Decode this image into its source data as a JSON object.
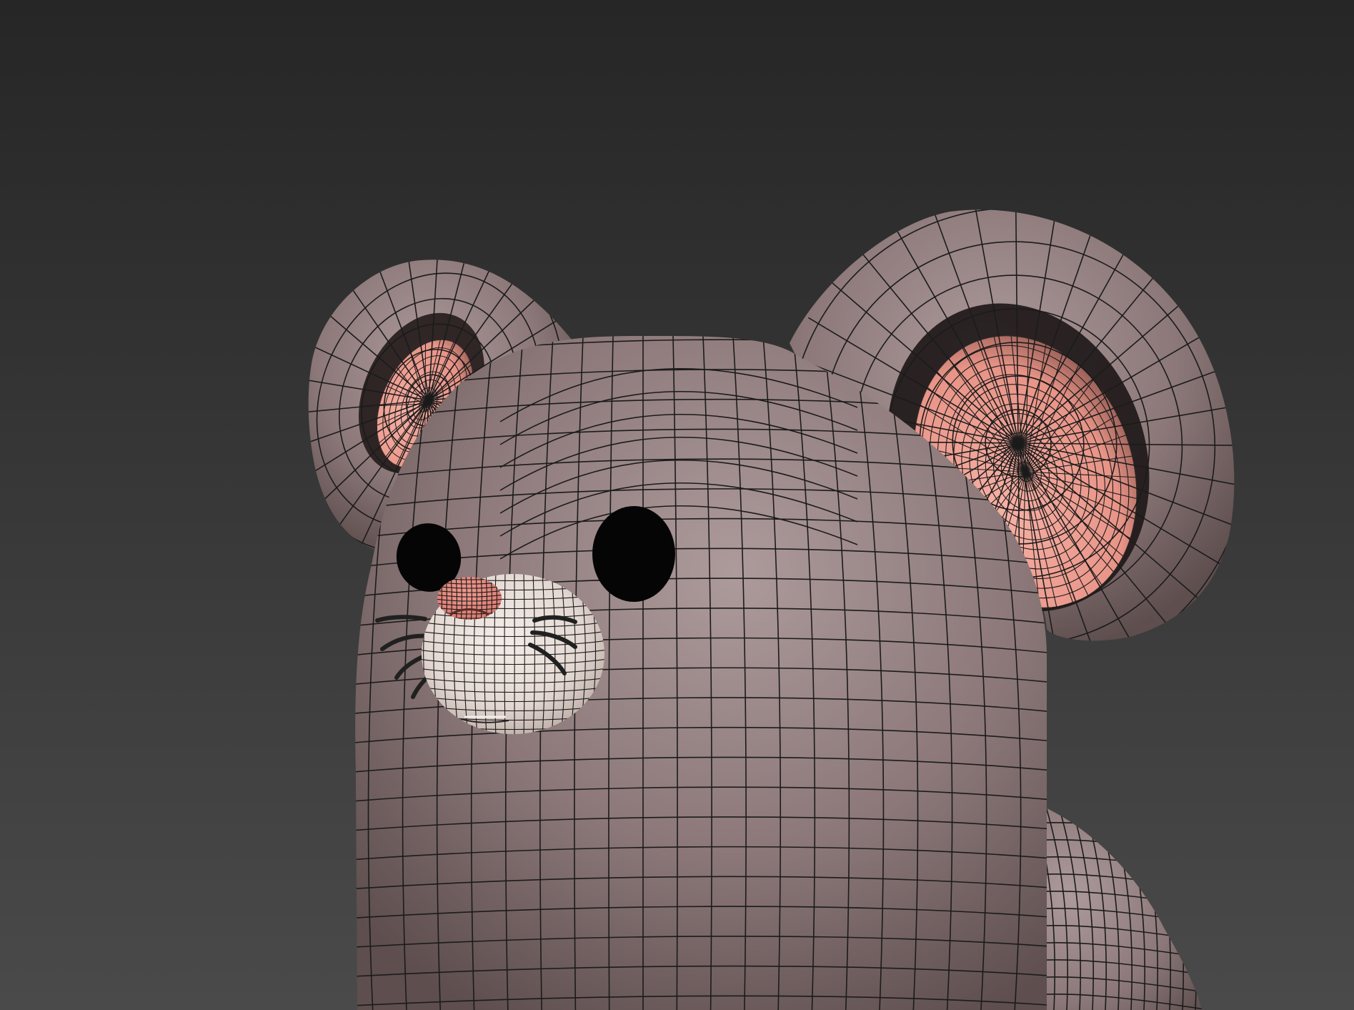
{
  "viewport": {
    "background_top": "#262626",
    "background_bottom": "#4a4a4a",
    "wireframe_color": "#1b1b1b"
  },
  "model": {
    "body_color": "#8c7878",
    "body_highlight": "#ad9a9a",
    "body_shadow": "#5e4e4e",
    "ear_inner_color": "#e89487",
    "ear_inner_highlight": "#f6b1a5",
    "muzzle_color": "#e4d8d2",
    "muzzle_shadow": "#b3a39c",
    "nose_color": "#d8786e",
    "eye_color": "#050505",
    "whisker_color": "#202020"
  }
}
